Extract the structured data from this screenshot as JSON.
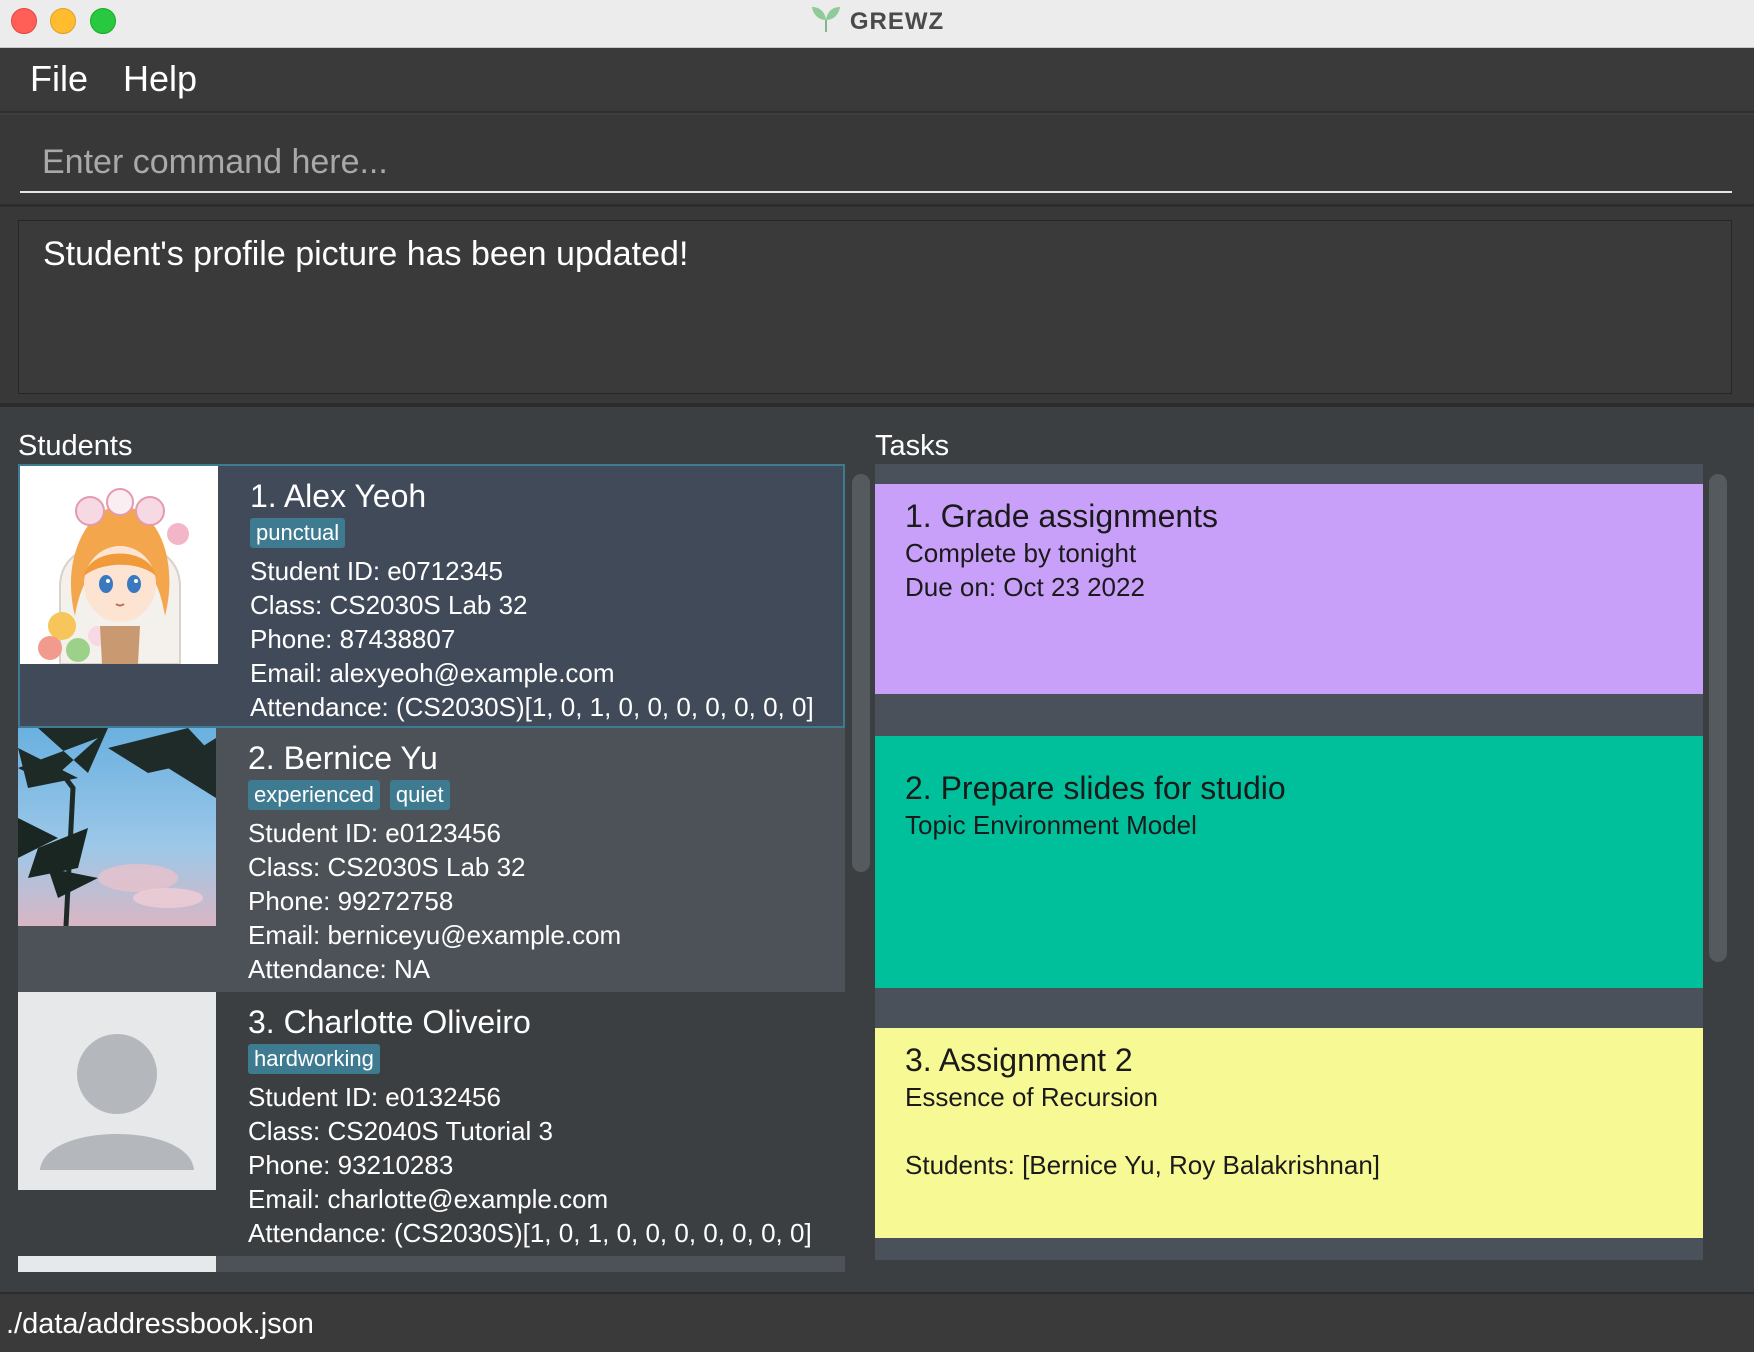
{
  "window": {
    "title": "GREWZ",
    "logo_icon": "leaf-icon"
  },
  "menu": {
    "file_label": "File",
    "help_label": "Help"
  },
  "command": {
    "placeholder": "Enter command here...",
    "value": ""
  },
  "result": {
    "message": "Student's profile picture has been updated!"
  },
  "students": {
    "label": "Students",
    "items": [
      {
        "name": "1.  Alex Yeoh",
        "tags": [
          "punctual"
        ],
        "student_id": "Student ID: e0712345",
        "class": "Class: CS2030S Lab 32",
        "phone": "Phone: 87438807",
        "email": "Email: alexyeoh@example.com",
        "attendance": "Attendance: (CS2030S)[1, 0, 1, 0, 0, 0, 0, 0, 0, 0]",
        "avatar": "anime-girl-picture"
      },
      {
        "name": "2.  Bernice Yu",
        "tags": [
          "experienced",
          "quiet"
        ],
        "student_id": "Student ID: e0123456",
        "class": "Class: CS2030S Lab 32",
        "phone": "Phone: 99272758",
        "email": "Email: berniceyu@example.com",
        "attendance": "Attendance: NA",
        "avatar": "palm-tree-sky-picture"
      },
      {
        "name": "3.  Charlotte Oliveiro",
        "tags": [
          "hardworking"
        ],
        "student_id": "Student ID: e0132456",
        "class": "Class: CS2040S Tutorial 3",
        "phone": "Phone: 93210283",
        "email": "Email: charlotte@example.com",
        "attendance": "Attendance: (CS2030S)[1, 0, 1, 0, 0, 0, 0, 0, 0, 0]",
        "avatar": "default-user-icon"
      }
    ]
  },
  "tasks": {
    "label": "Tasks",
    "items": [
      {
        "title": "1.  Grade assignments",
        "description": "Complete by tonight",
        "extra": "Due on: Oct 23 2022",
        "color": "#c8a0fa"
      },
      {
        "title": "2.  Prepare slides for studio",
        "description": "Topic Environment Model",
        "extra": "",
        "color": "#00c09c"
      },
      {
        "title": "3.  Assignment 2",
        "description": "Essence of Recursion",
        "extra": "Students: [Bernice Yu, Roy Balakrishnan]",
        "color": "#f7f994"
      }
    ]
  },
  "status": {
    "path": "./data/addressbook.json"
  },
  "colors": {
    "background": "#3c3f41",
    "tag": "#3e7b91",
    "selected_card": "#414a59",
    "card_alt": "#4c5257"
  }
}
